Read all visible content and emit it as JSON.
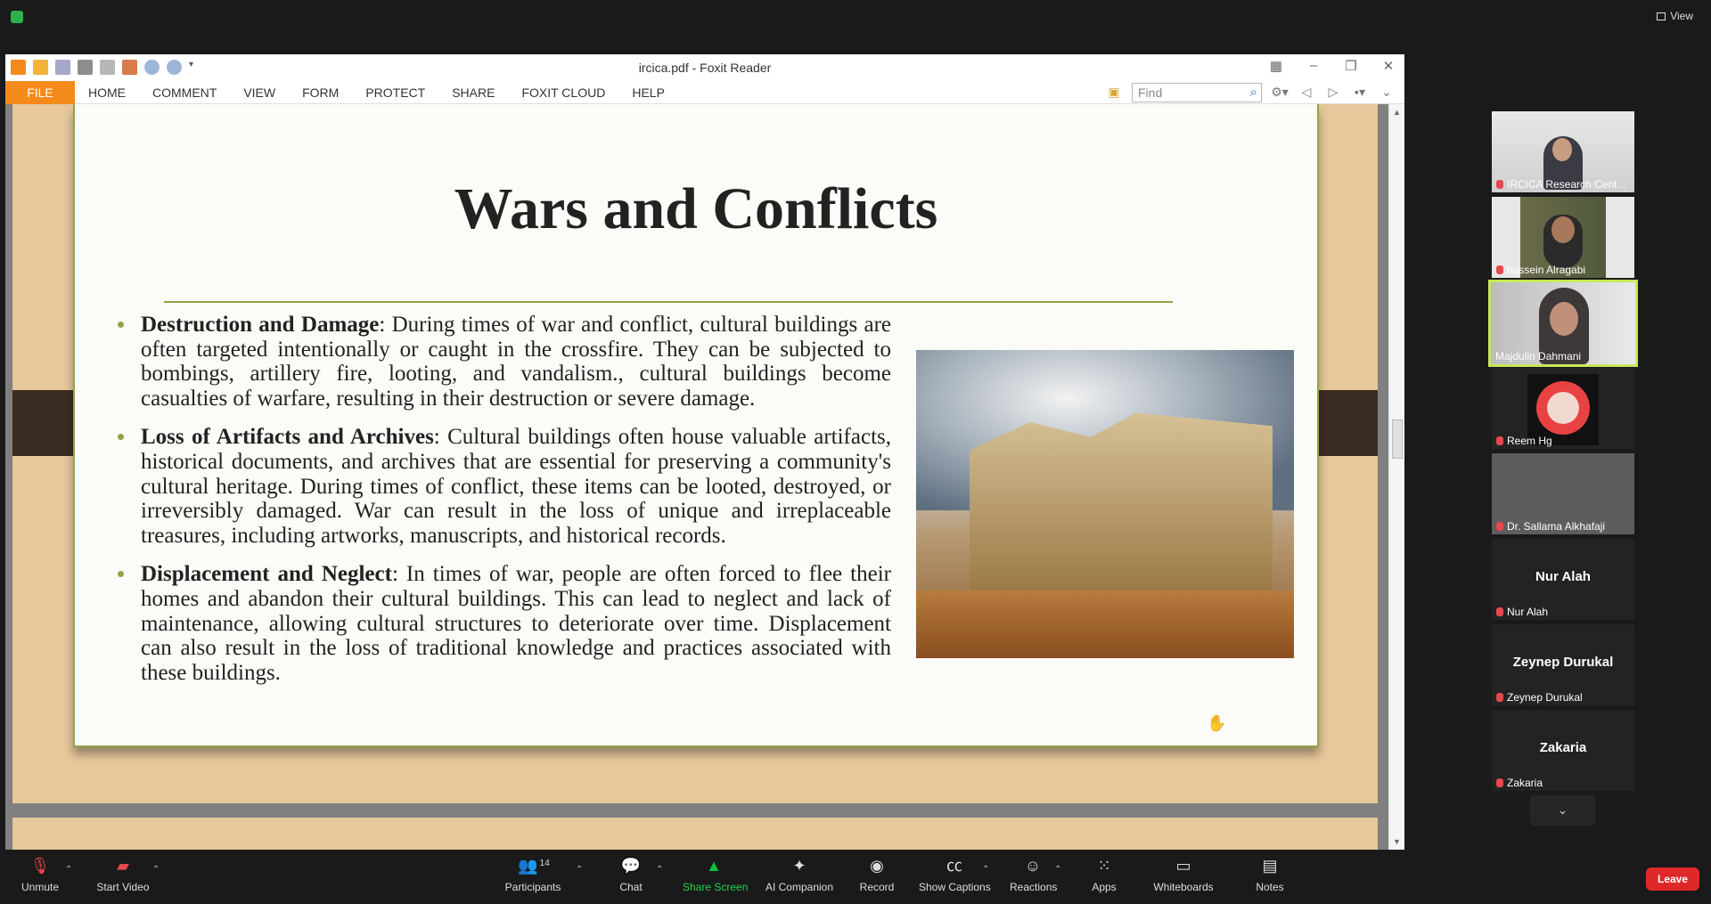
{
  "zoom_top": {
    "view_label": "View"
  },
  "foxit": {
    "window_title": "ircica.pdf - Foxit Reader",
    "menu": [
      "FILE",
      "HOME",
      "COMMENT",
      "VIEW",
      "FORM",
      "PROTECT",
      "SHARE",
      "FOXIT CLOUD",
      "HELP"
    ],
    "find_placeholder": "Find"
  },
  "slide": {
    "title": "Wars and Conflicts",
    "bullets": [
      {
        "heading": "Destruction and Damage",
        "text": ": During times of war and conflict, cultural buildings are often targeted intentionally or caught in the crossfire. They can be subjected to bombings, artillery fire, looting, and vandalism., cultural buildings become casualties of warfare, resulting in their destruction or severe damage."
      },
      {
        "heading": "Loss of Artifacts and Archives",
        "text": ": Cultural buildings often house valuable artifacts, historical documents, and archives that are essential for preserving a community's cultural heritage. During times of conflict, these items can be looted, destroyed, or irreversibly damaged. War can result in the loss of unique and irreplaceable treasures, including artworks, manuscripts, and historical records."
      },
      {
        "heading": "Displacement and Neglect",
        "text": ": In times of war, people are often forced to flee their homes and abandon their cultural buildings. This can lead to neglect and lack of maintenance, allowing cultural structures to deteriorate over time. Displacement can also result in the loss of traditional knowledge and practices associated with these buildings."
      }
    ]
  },
  "participants": [
    {
      "name": "IRCICA Research Cent...",
      "type": "video"
    },
    {
      "name": "hussein Alragabi",
      "type": "video"
    },
    {
      "name": "Majdulin Dahmani",
      "type": "video",
      "active": true
    },
    {
      "name": "Reem Hg",
      "type": "avatar"
    },
    {
      "name": "Dr. Sallama Alkhafaji",
      "type": "blur"
    },
    {
      "name": "Nur Alah",
      "type": "name"
    },
    {
      "name": "Zeynep Durukal",
      "type": "name"
    },
    {
      "name": "Zakaria",
      "type": "name"
    }
  ],
  "toolbar": {
    "unmute": "Unmute",
    "start_video": "Start Video",
    "participants": "Participants",
    "participants_count": "14",
    "chat": "Chat",
    "share_screen": "Share Screen",
    "ai_companion": "AI Companion",
    "record": "Record",
    "show_captions": "Show Captions",
    "reactions": "Reactions",
    "apps": "Apps",
    "whiteboards": "Whiteboards",
    "notes": "Notes",
    "leave": "Leave"
  },
  "colors": {
    "accent_green": "#8fa446",
    "foxit_orange": "#f48a1c",
    "leave_red": "#e02828",
    "share_green": "#0dbf3f",
    "active_border": "#c6e859"
  }
}
